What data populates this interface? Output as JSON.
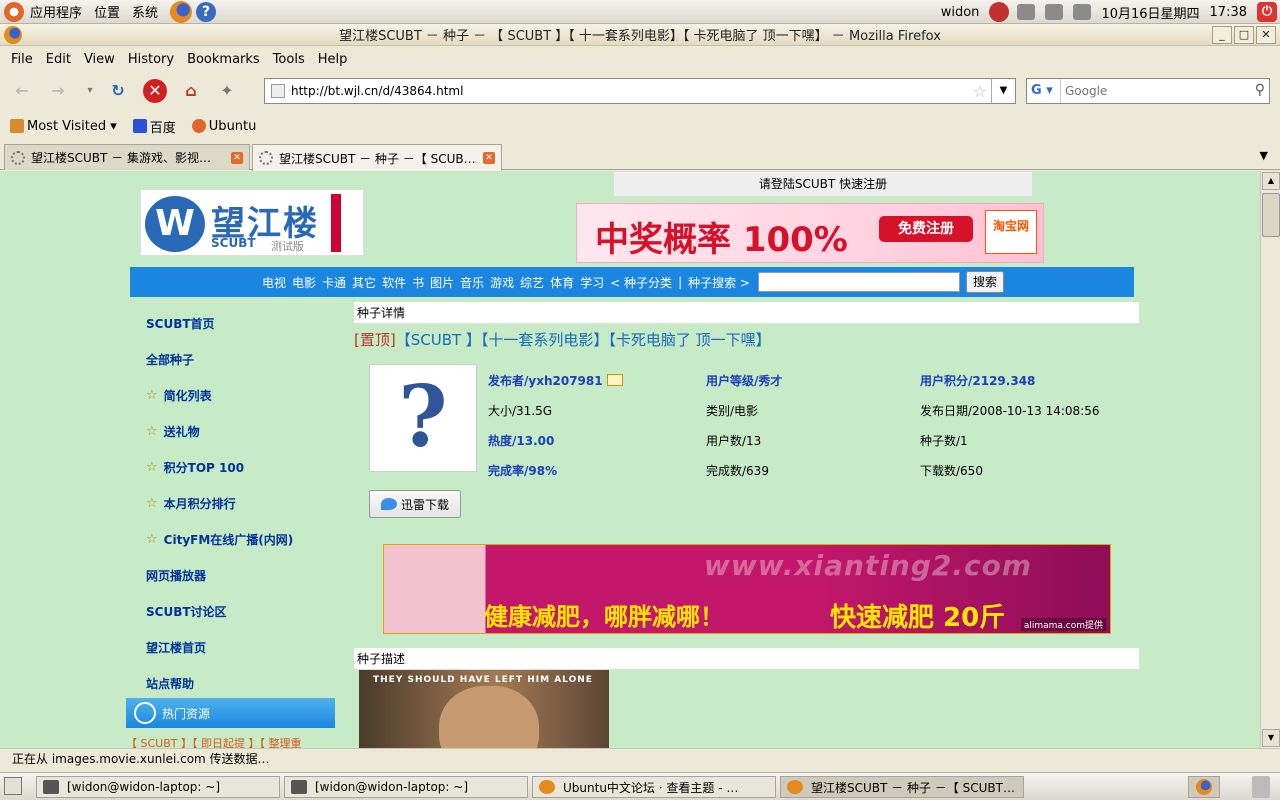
{
  "top_panel": {
    "apps_menu": "应用程序",
    "places_menu": "位置",
    "system_menu": "系统",
    "user": "widon",
    "datetime": "10月16日星期四",
    "time": "17:38"
  },
  "window": {
    "title": "望江楼SCUBT － 种子 － 【 SCUBT 】【 十一套系列电影】【 卡死电脑了  顶一下嘿】 － Mozilla Firefox"
  },
  "menubar": [
    "File",
    "Edit",
    "View",
    "History",
    "Bookmarks",
    "Tools",
    "Help"
  ],
  "navbar": {
    "url": "http://bt.wjl.cn/d/43864.html",
    "search_engine": "G",
    "search_placeholder": "Google"
  },
  "bookmarks": [
    {
      "label": "Most Visited ▾",
      "color": "#d98b2b"
    },
    {
      "label": "百度",
      "color": "#2a52d6"
    },
    {
      "label": "Ubuntu",
      "color": "#e0662a"
    }
  ],
  "tabs": [
    {
      "label": "望江楼SCUBT － 集游戏、影视…",
      "active": false
    },
    {
      "label": "望江楼SCUBT － 种子 －【 SCUB…",
      "active": true
    }
  ],
  "page": {
    "login_text": "请登陆SCUBT   快速注册",
    "logo": {
      "main": "望江楼",
      "sub": "SCUBT",
      "badge": "测试版"
    },
    "top_ad": {
      "headline": "中奖概率 100%",
      "button": "免费注册",
      "brand": "淘宝网"
    },
    "nav_links": [
      "电视",
      "电影",
      "卡通",
      "其它",
      "软件",
      "书",
      "图片",
      "音乐",
      "游戏",
      "综艺",
      "体育",
      "学习",
      "< 种子分类",
      "|",
      "种子搜索 >"
    ],
    "nav_search_button": "搜索",
    "sidebar": [
      {
        "label": "SCUBT首页",
        "star": false
      },
      {
        "label": "全部种子",
        "star": false
      },
      {
        "label": "简化列表",
        "star": true
      },
      {
        "label": "送礼物",
        "star": true
      },
      {
        "label": "积分TOP 100",
        "star": true
      },
      {
        "label": "本月积分排行",
        "star": true
      },
      {
        "label": "CityFM在线广播(内网)",
        "star": true
      },
      {
        "label": "网页播放器",
        "star": false
      },
      {
        "label": "SCUBT讨论区",
        "star": false
      },
      {
        "label": "望江楼首页",
        "star": false
      },
      {
        "label": "站点帮助",
        "star": false
      }
    ],
    "hot_header": "热门资源",
    "hot_item": "【 SCUBT 】【 即日起提 】【 整理重",
    "detail_header": "种子详情",
    "torrent_pin": "[置顶]",
    "torrent_title": "【SCUBT 】【十一套系列电影】【卡死电脑了  顶一下嘿】",
    "info": {
      "uploader": "发布者/yxh207981",
      "user_level": "用户等级/秀才",
      "user_points": "用户积分/2129.348",
      "size": "大小/31.5G",
      "category": "类别/电影",
      "publish_date": "发布日期/2008-10-13 14:08:56",
      "heat": "热度/13.00",
      "users": "用户数/13",
      "seeds": "种子数/1",
      "completion": "完成率/98%",
      "completed": "完成数/639",
      "downloads": "下载数/650"
    },
    "download_button": "迅雷下载",
    "mid_ad": {
      "url": "www.xianting2.com",
      "slogan": "健康减肥，哪胖减哪！",
      "fast": "快速减肥 20斤",
      "provider": "alimama.com提供"
    },
    "desc_header": "种子描述",
    "poster_text": "THEY SHOULD HAVE LEFT HIM ALONE"
  },
  "statusbar": "正在从 images.movie.xunlei.com 传送数据…",
  "taskbar": [
    {
      "label": "[widon@widon-laptop: ~]",
      "active": false
    },
    {
      "label": "[widon@widon-laptop: ~]",
      "active": false
    },
    {
      "label": "Ubuntu中文论坛 · 查看主题 - …",
      "active": false
    },
    {
      "label": "望江楼SCUBT － 种子 －【 SCUBT…",
      "active": true
    }
  ]
}
